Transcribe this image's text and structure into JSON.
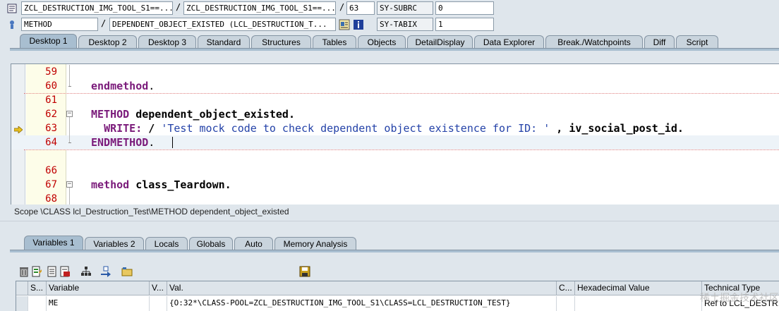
{
  "header": {
    "row1": {
      "program": "ZCL_DESTRUCTION_IMG_TOOL_S1==...",
      "include": "ZCL_DESTRUCTION_IMG_TOOL_S1==...",
      "line": "63",
      "sysfield_label": "SY-SUBRC",
      "sysfield_value": "0",
      "separator": "/"
    },
    "row2": {
      "event_type": "METHOD",
      "event": "DEPENDENT_OBJECT_EXISTED (LCL_DESTRUCTION_T...",
      "sysfield_label": "SY-TABIX",
      "sysfield_value": "1",
      "separator": "/"
    }
  },
  "desktop_tabs": [
    {
      "label": "Desktop 1",
      "active": true
    },
    {
      "label": "Desktop 2"
    },
    {
      "label": "Desktop 3"
    },
    {
      "label": "Standard"
    },
    {
      "label": "Structures"
    },
    {
      "label": "Tables"
    },
    {
      "label": "Objects"
    },
    {
      "label": "DetailDisplay"
    },
    {
      "label": "Data Explorer"
    },
    {
      "label": "Break./Watchpoints"
    },
    {
      "label": "Diff"
    },
    {
      "label": "Script"
    }
  ],
  "code_lines": [
    {
      "num": "59"
    },
    {
      "num": "60",
      "keyword": "endmethod",
      "rest": "."
    },
    {
      "num": "61"
    },
    {
      "num": "62",
      "keyword": "METHOD",
      "name": "dependent_object_existed",
      "rest": "."
    },
    {
      "num": "63",
      "keyword": "WRITE:",
      "slash": "/",
      "string": "'Test mock code to check dependent object existence for ID: '",
      "comma": ",",
      "var": "iv_social_post_id",
      "rest": "."
    },
    {
      "num": "64",
      "keyword": "ENDMETHOD",
      "rest": "."
    },
    {
      "num": "66"
    },
    {
      "num": "67",
      "keyword": "method",
      "name": "class_Teardown",
      "rest": "."
    },
    {
      "num": "68"
    }
  ],
  "scope": "Scope \\CLASS lcl_Destruction_Test\\METHOD dependent_object_existed",
  "variable_tabs": [
    {
      "label": "Variables 1",
      "active": true
    },
    {
      "label": "Variables 2"
    },
    {
      "label": "Locals"
    },
    {
      "label": "Globals"
    },
    {
      "label": "Auto"
    },
    {
      "label": "Memory Analysis"
    }
  ],
  "table": {
    "columns": [
      "S...",
      "Variable",
      "V...",
      "Val.",
      "C...",
      "Hexadecimal Value",
      "Technical Type"
    ],
    "rows": [
      {
        "variable": "ME",
        "value": "{O:32*\\CLASS-POOL=ZCL_DESTRUCTION_IMG_TOOL_S1\\CLASS=LCL_DESTRUCTION_TEST}",
        "type": "Ref to LCL_DESTR..."
      }
    ]
  },
  "watermark": "稀土掘金技术社区",
  "icons": [
    "program-icon",
    "method-icon",
    "source-icon",
    "info-icon",
    "delete-icon",
    "edit-icon",
    "doc-icon",
    "doc-save-icon",
    "hierarchy-icon",
    "move-icon",
    "folder-icon",
    "save-icon",
    "breakpoint-arrow-icon"
  ]
}
